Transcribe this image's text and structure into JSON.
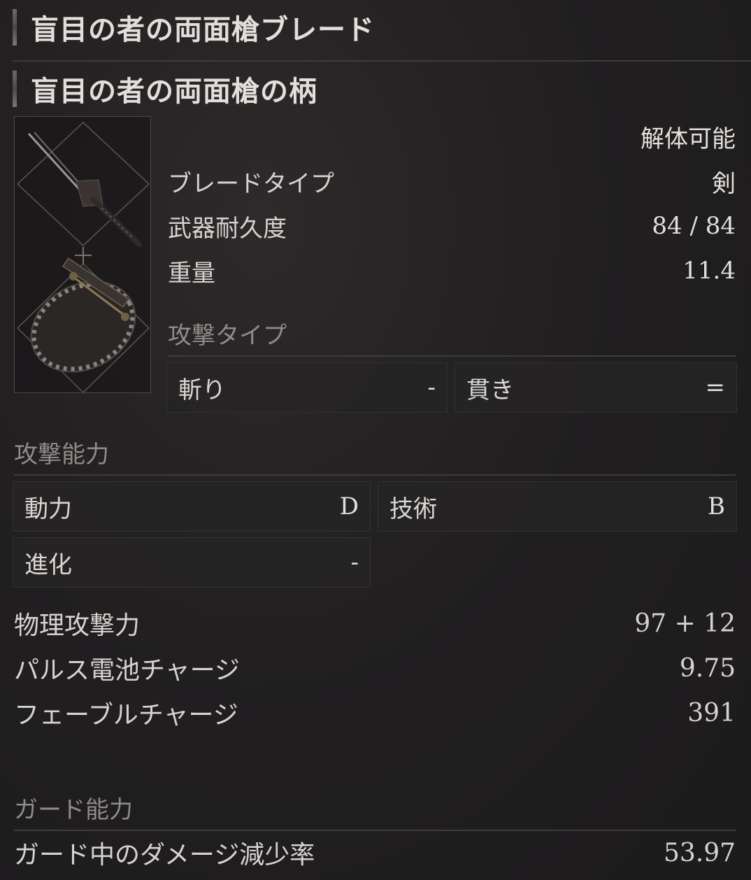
{
  "item": {
    "blade_name": "盲目の者の両面槍ブレード",
    "handle_name": "盲目の者の両面槍の柄"
  },
  "specs": {
    "dismantle": "解体可能",
    "blade_type_label": "ブレードタイプ",
    "blade_type_value": "剣",
    "durability_label": "武器耐久度",
    "durability_value": "84 / 84",
    "weight_label": "重量",
    "weight_value": "11.4"
  },
  "attack_type": {
    "heading": "攻撃タイプ",
    "items": [
      {
        "label": "斬り",
        "value": "-"
      },
      {
        "label": "貫き",
        "value": "="
      }
    ]
  },
  "attack_ability": {
    "heading": "攻撃能力",
    "scaling": [
      {
        "label": "動力",
        "value": "D"
      },
      {
        "label": "技術",
        "value": "B"
      },
      {
        "label": "進化",
        "value": "-"
      }
    ],
    "rows": [
      {
        "label": "物理攻撃力",
        "value": "97 + 12"
      },
      {
        "label": "パルス電池チャージ",
        "value": "9.75"
      },
      {
        "label": "フェーブルチャージ",
        "value": "391"
      }
    ]
  },
  "guard_ability": {
    "heading": "ガード能力",
    "rows": [
      {
        "label": "ガード中のダメージ減少率",
        "value": "53.97"
      }
    ]
  },
  "icons": [
    "blade-icon",
    "handle-icon",
    "plus-icon"
  ]
}
